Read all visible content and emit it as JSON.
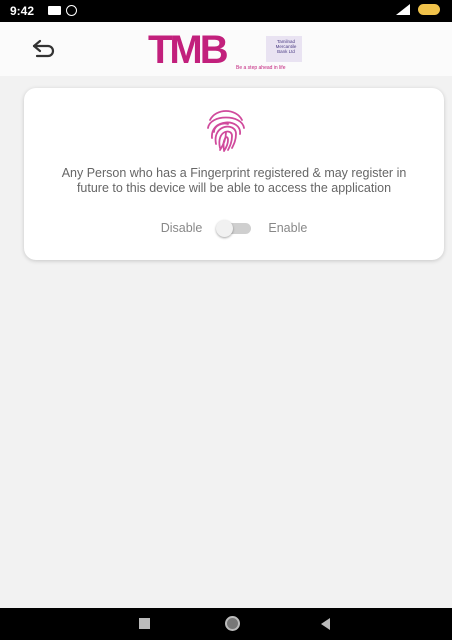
{
  "status_bar": {
    "time": "9:42",
    "icons": [
      "message-icon",
      "whatsapp-icon",
      "signal-icon",
      "battery-icon"
    ]
  },
  "header": {
    "back_icon": "back-arrow-icon",
    "logo": {
      "letters": "TMB",
      "bank_name_lines": [
        "Tamilnad",
        "Mercantile",
        "Bank Ltd"
      ],
      "tagline": "Be a step ahead in life",
      "brand_color": "#c2207c"
    }
  },
  "fingerprint_card": {
    "icon": "fingerprint-icon",
    "icon_color": "#d04a9c",
    "message": "Any Person who has a Fingerprint registered & may register in future to this device will be able to access the application",
    "toggle": {
      "disable_label": "Disable",
      "enable_label": "Enable",
      "state": "off"
    }
  },
  "nav_bar": {
    "buttons": [
      "recent-apps-icon",
      "home-icon",
      "back-icon"
    ]
  }
}
